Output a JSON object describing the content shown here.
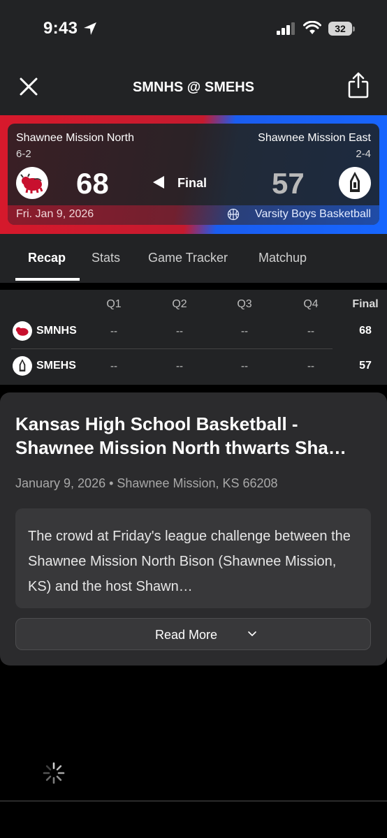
{
  "status_bar": {
    "time": "9:43",
    "battery": "32"
  },
  "nav": {
    "title": "SMNHS @ SMEHS"
  },
  "game": {
    "home": {
      "name": "Shawnee Mission North",
      "record": "6-2",
      "score": "68",
      "abbr": "SMNHS"
    },
    "away": {
      "name": "Shawnee Mission East",
      "record": "2-4",
      "score": "57",
      "abbr": "SMEHS"
    },
    "status": "Final",
    "date": "Fri. Jan 9, 2026",
    "sport": "Varsity Boys Basketball"
  },
  "tabs": [
    "Recap",
    "Stats",
    "Game Tracker",
    "Matchup"
  ],
  "box_score": {
    "headers": [
      "Q1",
      "Q2",
      "Q3",
      "Q4",
      "Final"
    ],
    "rows": [
      {
        "team": "SMNHS",
        "quarters": [
          "--",
          "--",
          "--",
          "--"
        ],
        "final": "68"
      },
      {
        "team": "SMEHS",
        "quarters": [
          "--",
          "--",
          "--",
          "--"
        ],
        "final": "57"
      }
    ]
  },
  "recap": {
    "headline": "Kansas High School Basketball - Shawnee Mission North thwarts Sha…",
    "meta": "January 9, 2026 • Shawnee Mission, KS 66208",
    "snippet": "The crowd at Friday's league challenge between the Shawnee Mission North Bison (Shawnee Mission, KS) and the host Shawn…",
    "read_more": "Read More"
  },
  "colors": {
    "home": "#d7192c",
    "away": "#1766ff",
    "background": "#222325"
  }
}
